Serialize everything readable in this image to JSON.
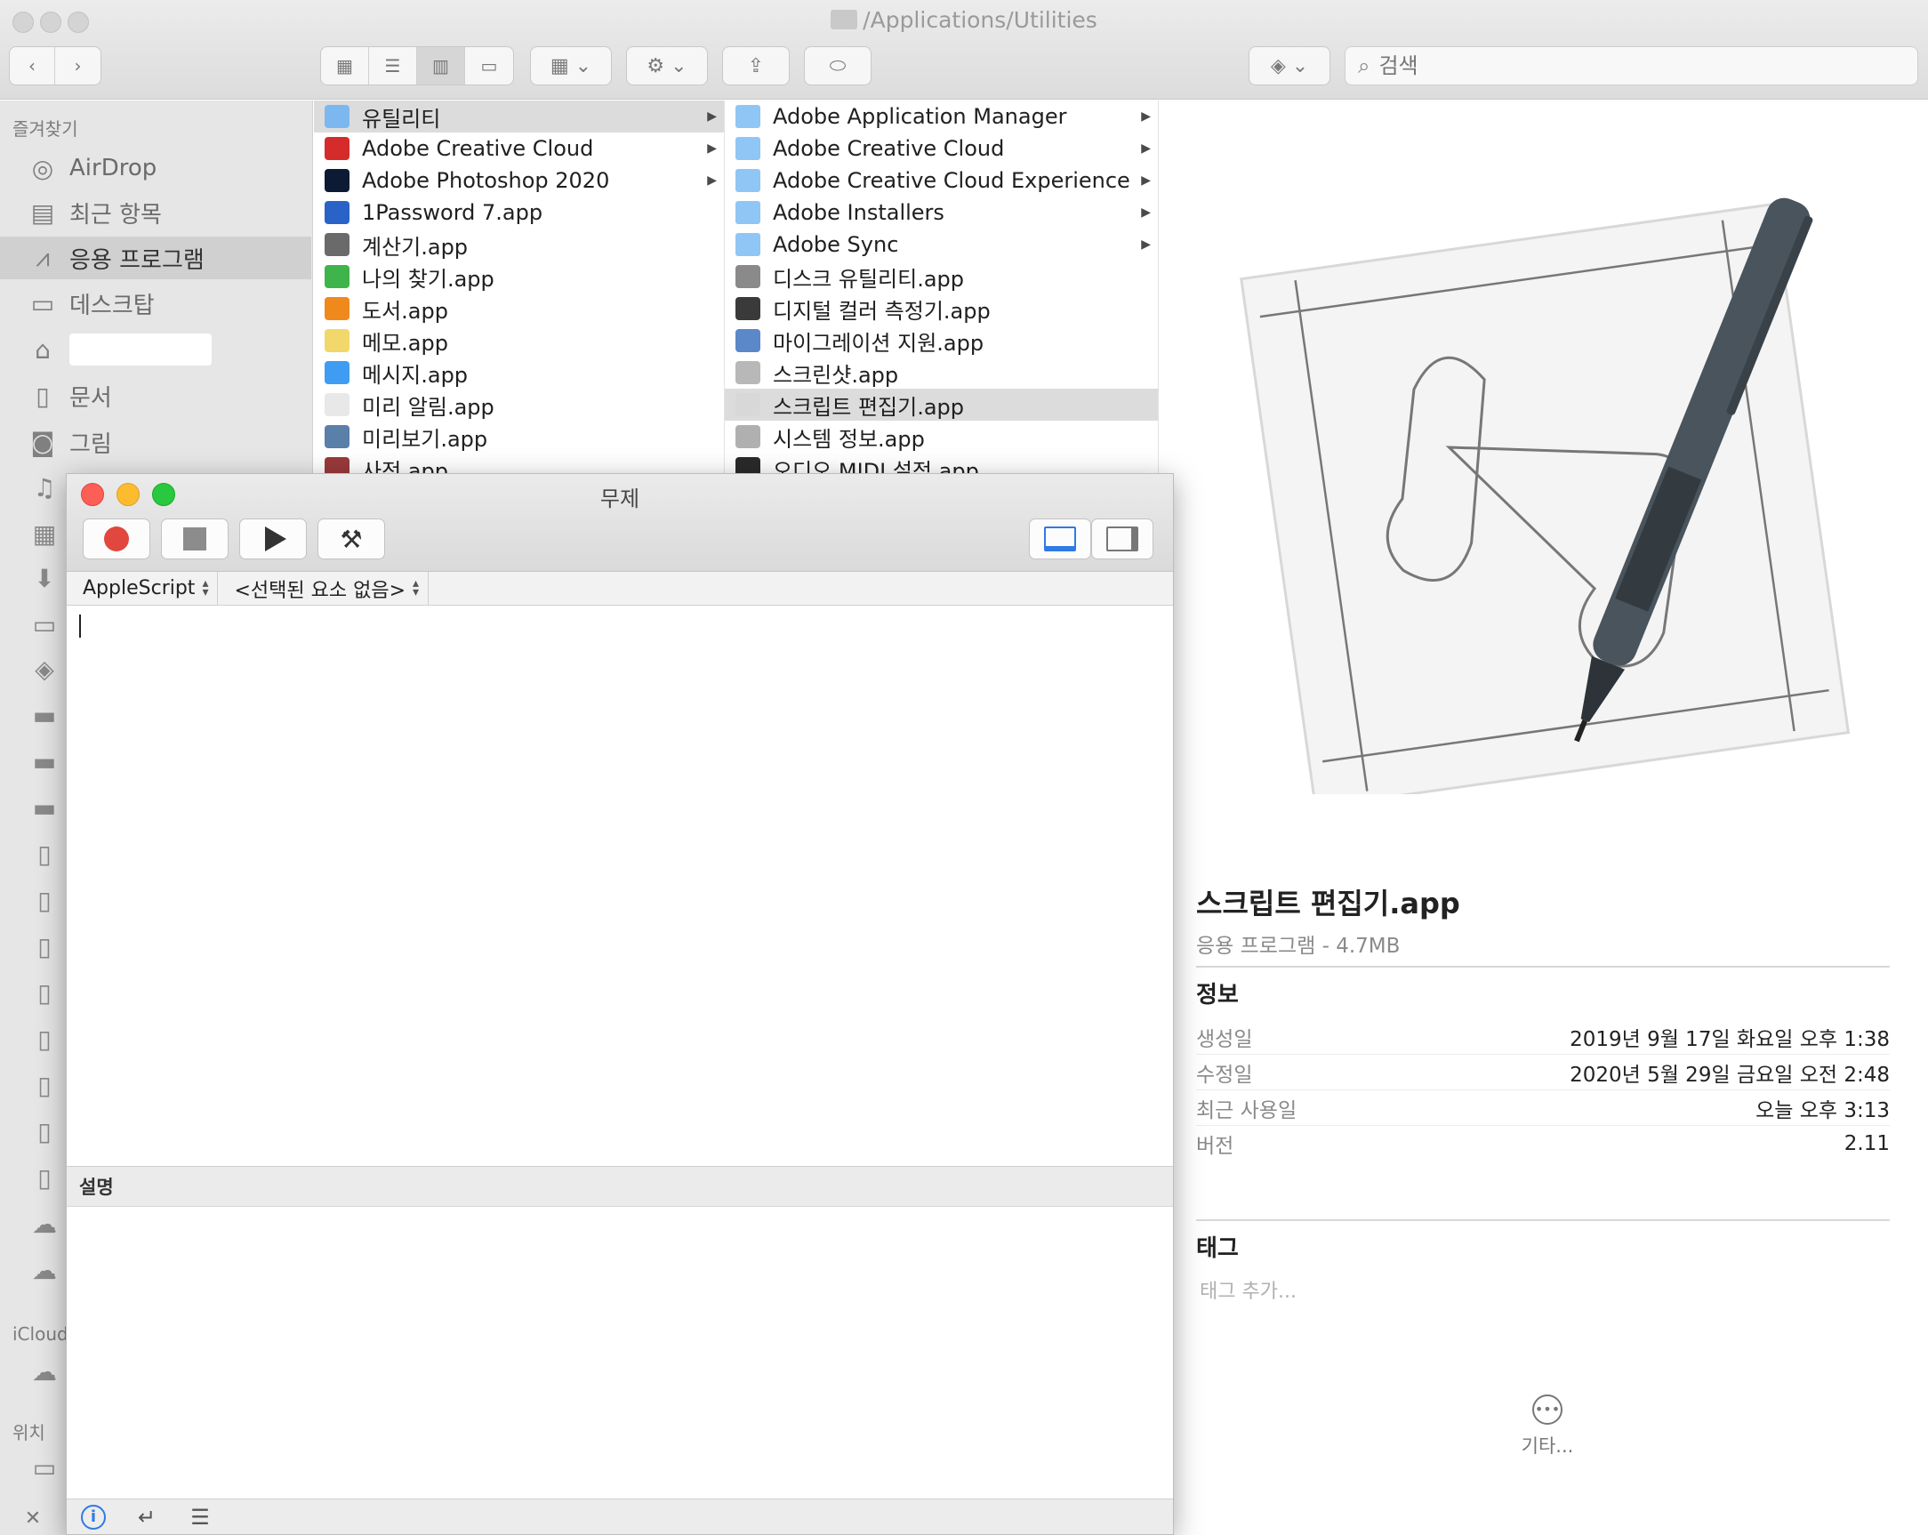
{
  "finder": {
    "title": "/Applications/Utilities",
    "search_placeholder": "검색"
  },
  "sidebar": {
    "favorites_header": "즐겨찾기",
    "items": [
      {
        "label": "AirDrop",
        "icon": "airdrop-icon"
      },
      {
        "label": "최근 항목",
        "icon": "recents-icon"
      },
      {
        "label": "응용 프로그램",
        "icon": "applications-icon"
      },
      {
        "label": "데스크탑",
        "icon": "desktop-icon"
      },
      {
        "label": "",
        "icon": "home-icon"
      },
      {
        "label": "문서",
        "icon": "documents-icon"
      },
      {
        "label": "그림",
        "icon": "pictures-icon"
      }
    ],
    "icloud_header": "iCloud",
    "locations_header": "위치"
  },
  "col1": [
    {
      "label": "유틸리티",
      "arrow": true,
      "selected": true,
      "color": "#7cb8ef"
    },
    {
      "label": "Adobe Creative Cloud",
      "arrow": true,
      "color": "#d62b2b"
    },
    {
      "label": "Adobe Photoshop 2020",
      "arrow": true,
      "color": "#0c1a34"
    },
    {
      "label": "1Password 7.app",
      "color": "#2a63c8"
    },
    {
      "label": "계산기.app",
      "color": "#6a6a6a"
    },
    {
      "label": "나의 찾기.app",
      "color": "#3fb44a"
    },
    {
      "label": "도서.app",
      "color": "#f0891c"
    },
    {
      "label": "메모.app",
      "color": "#f2d76a"
    },
    {
      "label": "메시지.app",
      "color": "#3e9df2"
    },
    {
      "label": "미리 알림.app",
      "color": "#e8e8e8"
    },
    {
      "label": "미리보기.app",
      "color": "#5a7fa8"
    },
    {
      "label": "사전.app",
      "color": "#9a3a3a"
    }
  ],
  "col2": [
    {
      "label": "Adobe Application Manager",
      "arrow": true,
      "folder": true
    },
    {
      "label": "Adobe Creative Cloud",
      "arrow": true,
      "folder": true
    },
    {
      "label": "Adobe Creative Cloud Experience",
      "arrow": true,
      "folder": true
    },
    {
      "label": "Adobe Installers",
      "arrow": true,
      "folder": true
    },
    {
      "label": "Adobe Sync",
      "arrow": true,
      "folder": true
    },
    {
      "label": "디스크 유틸리티.app",
      "color": "#8a8a8a"
    },
    {
      "label": "디지털 컬러 측정기.app",
      "color": "#3a3a3a"
    },
    {
      "label": "마이그레이션 지원.app",
      "color": "#5a88c8"
    },
    {
      "label": "스크린샷.app",
      "color": "#b8b8b8"
    },
    {
      "label": "스크립트 편집기.app",
      "selected": true,
      "color": "#d8d8d8"
    },
    {
      "label": "시스템 정보.app",
      "color": "#b0b0b0"
    },
    {
      "label": "오디오 MIDI 설정.app",
      "color": "#2a2a2a"
    }
  ],
  "preview": {
    "name": "스크립트 편집기.app",
    "kind": "응용 프로그램 - 4.7MB",
    "info_title": "정보",
    "info": [
      {
        "k": "생성일",
        "v": "2019년 9월 17일 화요일 오후 1:38"
      },
      {
        "k": "수정일",
        "v": "2020년 5월 29일 금요일 오전 2:48"
      },
      {
        "k": "최근 사용일",
        "v": "오늘 오후 3:13"
      },
      {
        "k": "버전",
        "v": "2.11"
      }
    ],
    "tags_title": "태그",
    "tag_placeholder": "태그 추가...",
    "more_label": "기타..."
  },
  "editor": {
    "title": "무제",
    "language": "AppleScript",
    "element": "<선택된 요소 없음>",
    "description_label": "설명"
  }
}
